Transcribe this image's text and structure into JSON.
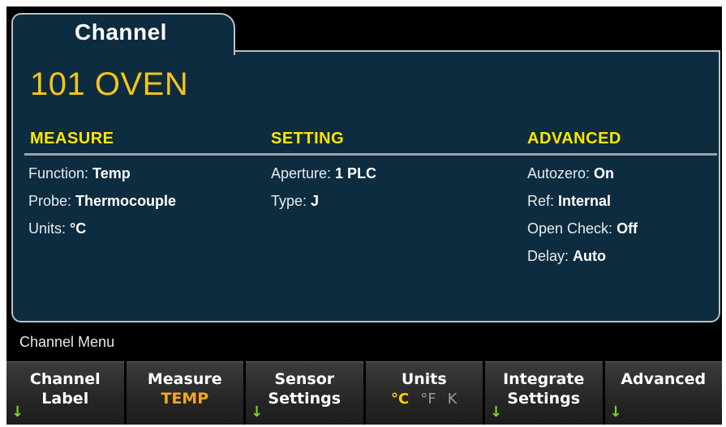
{
  "tab": {
    "label": "Channel"
  },
  "channel_id": "101 OVEN",
  "sections": {
    "measure": {
      "heading": "MEASURE",
      "fields": [
        {
          "label": "Function: ",
          "value": "Temp"
        },
        {
          "label": "Probe: ",
          "value": "Thermocouple"
        },
        {
          "label": "Units: ",
          "value": "°C"
        }
      ]
    },
    "setting": {
      "heading": "SETTING",
      "fields": [
        {
          "label": "Aperture: ",
          "value": "1 PLC"
        },
        {
          "label": "Type: ",
          "value": "J"
        }
      ]
    },
    "advanced": {
      "heading": "ADVANCED",
      "fields": [
        {
          "label": "Autozero: ",
          "value": "On"
        },
        {
          "label": "Ref: ",
          "value": "Internal"
        },
        {
          "label": "Open Check: ",
          "value": "Off"
        },
        {
          "label": "Delay: ",
          "value": "Auto"
        }
      ]
    }
  },
  "menu": {
    "title": "Channel Menu",
    "softkeys": [
      {
        "line1": "Channel",
        "line2": "Label",
        "arrow": "↓"
      },
      {
        "line1": "Measure",
        "sub": "TEMP"
      },
      {
        "line1": "Sensor",
        "line2": "Settings",
        "arrow": "↓"
      },
      {
        "line1": "Units",
        "units": [
          "°C",
          "°F",
          "K"
        ]
      },
      {
        "line1": "Integrate",
        "line2": "Settings",
        "arrow": "↓"
      },
      {
        "line1": "Advanced",
        "arrow": "↓"
      }
    ]
  },
  "colors": {
    "panel_bg": "#0d2c3f",
    "heading": "#ffe600",
    "channel_id": "#f5c518",
    "active_value": "#f5a623",
    "arrow": "#7fd321"
  }
}
